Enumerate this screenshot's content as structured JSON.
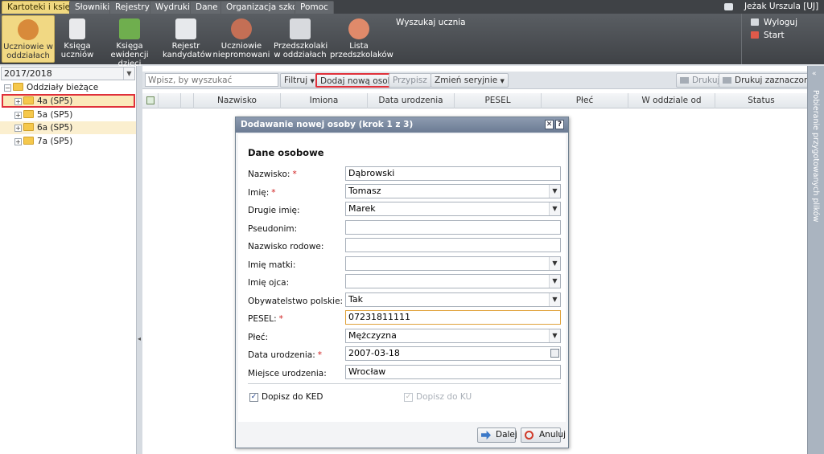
{
  "menu": {
    "tabs": [
      "Kartoteki i księgi",
      "Słowniki",
      "Rejestry",
      "Wydruki",
      "Dane",
      "Organizacja szkoły",
      "Pomoc"
    ],
    "active_index": 0
  },
  "toolbar": {
    "buttons": [
      {
        "line1": "Uczniowie w",
        "line2": "oddziałach",
        "icon": "student-icon"
      },
      {
        "line1": "Księga",
        "line2": "uczniów",
        "icon": "book-icon"
      },
      {
        "line1": "Księga",
        "line2": "ewidencji dzieci",
        "icon": "book-map-icon"
      },
      {
        "line1": "Rejestr",
        "line2": "kandydatów",
        "icon": "register-icon"
      },
      {
        "line1": "Uczniowie",
        "line2": "niepromowani",
        "icon": "student-down-icon"
      },
      {
        "line1": "Przedszkolaki",
        "line2": "w oddziałach",
        "icon": "preschool-icon"
      },
      {
        "line1": "Lista",
        "line2": "przedszkolaków",
        "icon": "children-icon"
      }
    ],
    "search_label": "Wyszukaj ucznia",
    "user_name": "Jeżak Urszula [UJ]",
    "logout": "Wyloguj",
    "start": "Start"
  },
  "left": {
    "year": "2017/2018",
    "tree_root": "Oddziały bieżące",
    "classes": [
      "4a (SP5)",
      "5a (SP5)",
      "6a (SP5)",
      "7a (SP5)"
    ],
    "selected_index": 0
  },
  "main": {
    "filter_placeholder": "Wpisz, by wyszukać",
    "filter_btn": "Filtruj",
    "add_person_btn": "Dodaj nową osobę",
    "assign_btn": "Przypisz",
    "change_serial_btn": "Zmień seryjnie",
    "print_btn": "Drukuj",
    "print_selected_btn": "Drukuj zaznaczone",
    "columns": [
      "Nazwisko",
      "Imiona",
      "Data urodzenia",
      "PESEL",
      "Płeć",
      "W oddziale od",
      "Status"
    ]
  },
  "right_panel_title": "Pobieranie przygotowanych plików",
  "dialog": {
    "title": "Dodawanie nowej osoby (krok 1 z 3)",
    "section": "Dane osobowe",
    "fields": [
      {
        "label": "Nazwisko:",
        "value": "Dąbrowski",
        "required": true,
        "type": "text"
      },
      {
        "label": "Imię:",
        "value": "Tomasz",
        "required": true,
        "type": "select"
      },
      {
        "label": "Drugie imię:",
        "value": "Marek",
        "required": false,
        "type": "select"
      },
      {
        "label": "Pseudonim:",
        "value": "",
        "required": false,
        "type": "text"
      },
      {
        "label": "Nazwisko rodowe:",
        "value": "",
        "required": false,
        "type": "text"
      },
      {
        "label": "Imię matki:",
        "value": "",
        "required": false,
        "type": "select"
      },
      {
        "label": "Imię ojca:",
        "value": "",
        "required": false,
        "type": "select"
      },
      {
        "label": "Obywatelstwo polskie:",
        "value": "Tak",
        "required": false,
        "type": "select"
      },
      {
        "label": "PESEL:",
        "value": "07231811111",
        "required": true,
        "type": "text"
      },
      {
        "label": "Płeć:",
        "value": "Mężczyzna",
        "required": false,
        "type": "select"
      },
      {
        "label": "Data urodzenia:",
        "value": "2007-03-18",
        "required": true,
        "type": "date"
      },
      {
        "label": "Miejsce urodzenia:",
        "value": "Wrocław",
        "required": false,
        "type": "text"
      }
    ],
    "checkbox_ked": "Dopisz do KED",
    "checkbox_ked_checked": true,
    "checkbox_ku": "Dopisz do KU",
    "checkbox_ku_checked": true,
    "next_btn": "Dalej",
    "cancel_btn": "Anuluj"
  },
  "colors": {
    "accent": "#f1d883",
    "highlight_border": "#e0303a",
    "menubar": "#3f4246",
    "dialog_titlebar": "#7585a0",
    "required": "#d02020"
  }
}
